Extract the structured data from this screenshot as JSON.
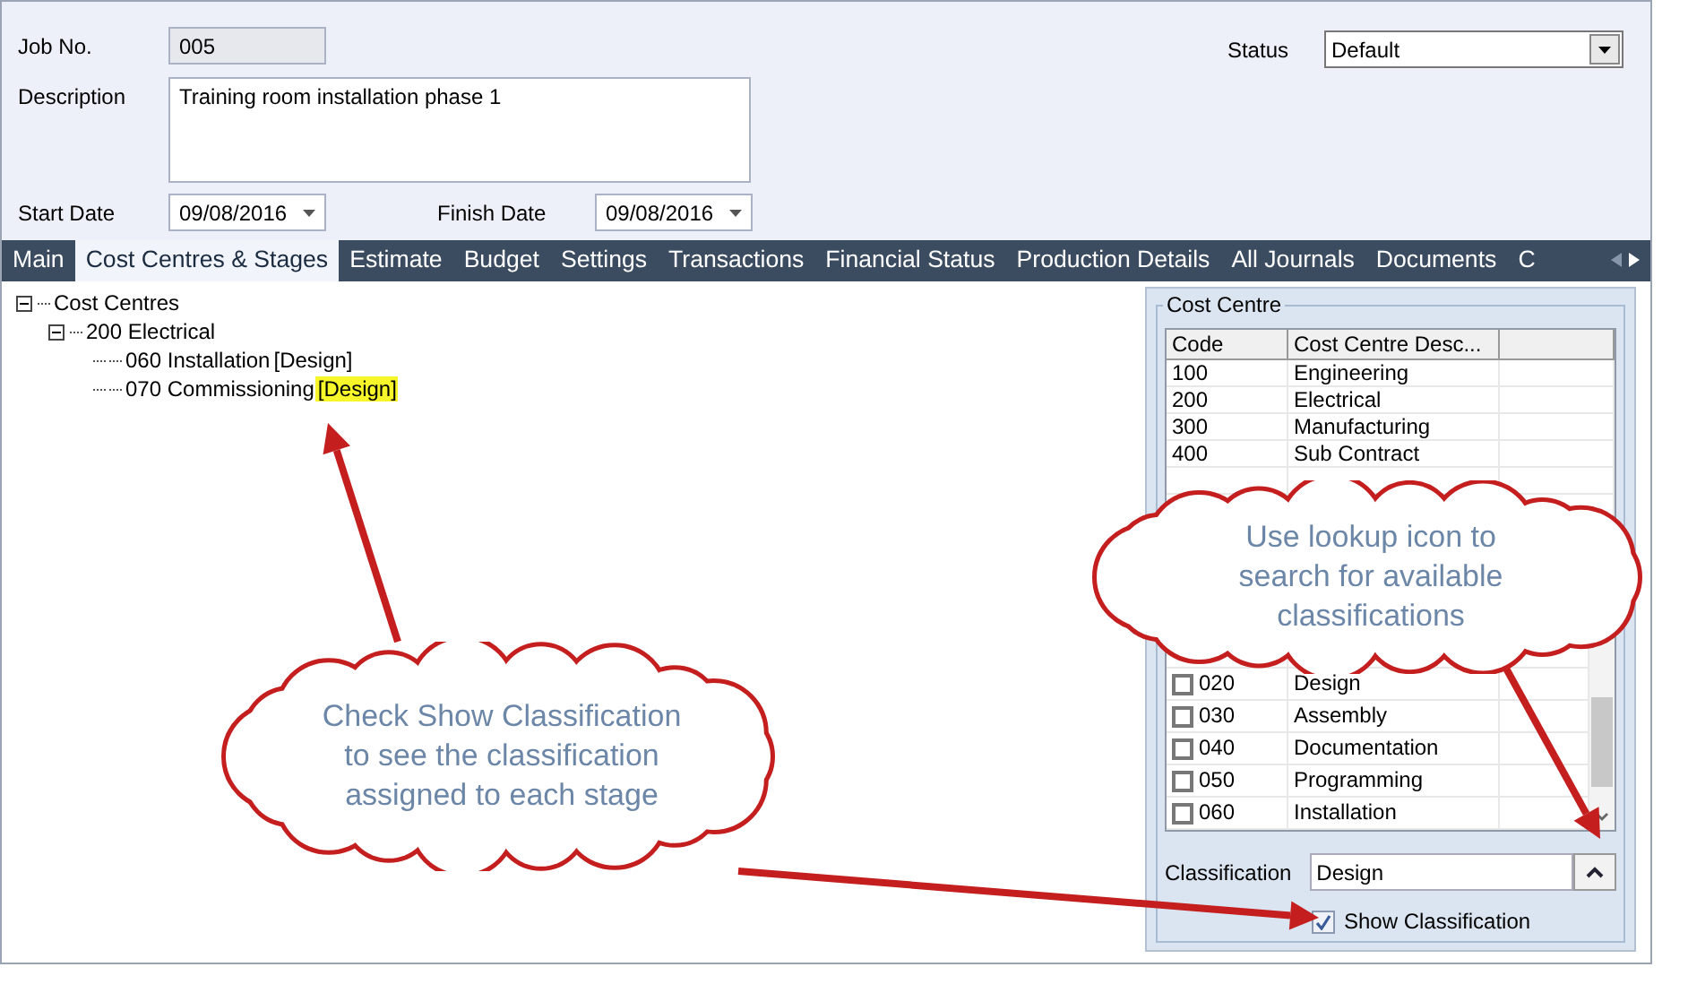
{
  "form": {
    "job_no": {
      "label": "Job No.",
      "value": "005"
    },
    "description": {
      "label": "Description",
      "value": "Training room installation phase 1"
    },
    "start_date": {
      "label": "Start Date",
      "value": "09/08/2016"
    },
    "finish_date": {
      "label": "Finish Date",
      "value": "09/08/2016"
    },
    "status": {
      "label": "Status",
      "value": "Default"
    }
  },
  "tabs": [
    {
      "label": "Main",
      "selected": false
    },
    {
      "label": "Cost Centres & Stages",
      "selected": true
    },
    {
      "label": "Estimate",
      "selected": false
    },
    {
      "label": "Budget",
      "selected": false
    },
    {
      "label": "Settings",
      "selected": false
    },
    {
      "label": "Transactions",
      "selected": false
    },
    {
      "label": "Financial Status",
      "selected": false
    },
    {
      "label": "Production Details",
      "selected": false
    },
    {
      "label": "All Journals",
      "selected": false
    },
    {
      "label": "Documents",
      "selected": false
    },
    {
      "label": "C",
      "selected": false
    }
  ],
  "tree": {
    "label": "Cost Centres",
    "expanded": true,
    "children": [
      {
        "label": "200 Electrical",
        "expanded": true,
        "children": [
          {
            "label": "060 Installation",
            "classification": "[Design]",
            "highlighted": false
          },
          {
            "label": "070 Commissioning",
            "classification": "[Design]",
            "highlighted": true
          }
        ]
      }
    ]
  },
  "cost_centre_panel": {
    "title": "Cost Centre",
    "columns": [
      "Code",
      "Cost Centre Desc..."
    ],
    "rows": [
      {
        "code": "100",
        "description": "Engineering"
      },
      {
        "code": "200",
        "description": "Electrical"
      },
      {
        "code": "300",
        "description": "Manufacturing"
      },
      {
        "code": "400",
        "description": "Sub Contract"
      }
    ],
    "stages": [
      {
        "code": "020",
        "description": "Design",
        "checked": false
      },
      {
        "code": "030",
        "description": "Assembly",
        "checked": false
      },
      {
        "code": "040",
        "description": "Documentation",
        "checked": false
      },
      {
        "code": "050",
        "description": "Programming",
        "checked": false
      },
      {
        "code": "060",
        "description": "Installation",
        "checked": false
      }
    ],
    "classification": {
      "label": "Classification",
      "value": "Design"
    },
    "show_classification": {
      "label": "Show Classification",
      "checked": true
    }
  },
  "callouts": [
    {
      "text": "Use lookup icon to search for available classifications"
    },
    {
      "text": "Check Show Classification to see the classification assigned to each stage"
    }
  ]
}
